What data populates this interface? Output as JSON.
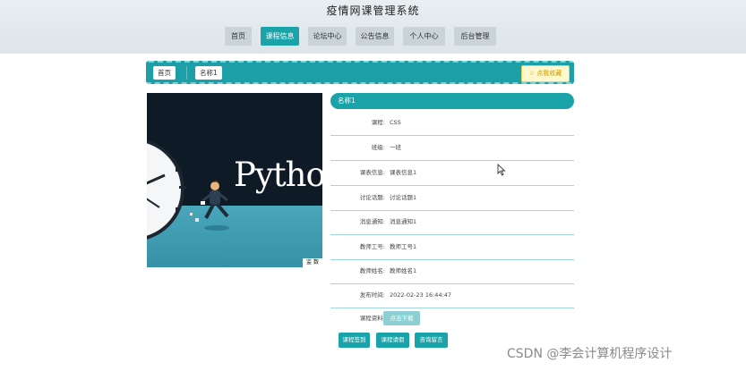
{
  "site": {
    "title": "疫情网课管理系统"
  },
  "nav": {
    "items": [
      {
        "label": "首页"
      },
      {
        "label": "课程信息"
      },
      {
        "label": "论坛中心"
      },
      {
        "label": "公告信息"
      },
      {
        "label": "个人中心"
      },
      {
        "label": "后台管理"
      }
    ],
    "active_index": 1
  },
  "breadcrumb": {
    "home": "首页",
    "current": "名称1",
    "favorite_label": "☆ 点我收藏"
  },
  "course": {
    "image_caption": "Pytho",
    "image_badge": "监 数",
    "title": "名称1",
    "fields": [
      {
        "label": "课程:",
        "value": "CSS"
      },
      {
        "label": "班级:",
        "value": "一班"
      },
      {
        "label": "课表信息:",
        "value": "课表信息1"
      },
      {
        "label": "讨论话题:",
        "value": "讨论话题1"
      },
      {
        "label": "消息通知:",
        "value": "消息通知1"
      },
      {
        "label": "教师工号:",
        "value": "教师工号1"
      },
      {
        "label": "教师姓名:",
        "value": "教师姓名1"
      },
      {
        "label": "发布时间:",
        "value": "2022-02-23 16:44:47"
      }
    ],
    "material": {
      "label": "课程资料:",
      "button": "点击下载"
    },
    "actions": [
      {
        "label": "课程签到"
      },
      {
        "label": "课程请假"
      },
      {
        "label": "咨询留言"
      }
    ]
  },
  "watermark": "CSDN @李会计算机程序设计",
  "colors": {
    "accent": "#1aa3a8",
    "accent_light": "#8dd0d3",
    "nav_bg": "#c9d3d8",
    "favorite_bg": "#fff8cf"
  }
}
